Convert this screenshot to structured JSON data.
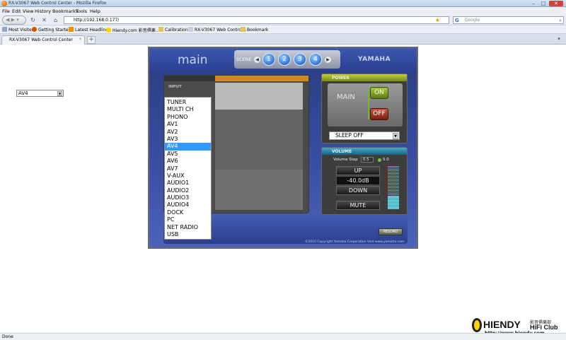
{
  "window": {
    "title": "RX-V3067 Web Control Center - Mozilla Firefox",
    "min": "–",
    "max": "□",
    "close": "✕"
  },
  "menu": [
    "File",
    "Edit",
    "View",
    "History",
    "Bookmarks",
    "Tools",
    "Help"
  ],
  "nav": {
    "url": "http://192.168.0.177/",
    "search_placeholder": "Google"
  },
  "bookmarks": [
    "Most Visited",
    "Getting Started",
    "Latest Headlines",
    "Hiendy.com 影音俱樂...",
    "Calibration",
    "RX-V3067 Web Control...",
    "Bookmark"
  ],
  "tabs": [
    {
      "label": "RX-V3067 Web Control Center"
    }
  ],
  "status": "Done",
  "app": {
    "title": "main",
    "scene_label": "SCENE",
    "scenes": [
      "1",
      "2",
      "3",
      "4"
    ],
    "brand": "YAMAHA",
    "input_label": "INPUT",
    "input_selected": "AV4",
    "input_options": [
      "TUNER",
      "MULTI CH",
      "PHONO",
      "AV1",
      "AV2",
      "AV3",
      "AV4",
      "AV5",
      "AV6",
      "AV7",
      "V-AUX",
      "AUDIO1",
      "AUDIO2",
      "AUDIO3",
      "AUDIO4",
      "DOCK",
      "PC",
      "NET RADIO",
      "USB"
    ],
    "power": {
      "header": "POWER",
      "zone": "MAIN",
      "on": "ON",
      "off": "OFF",
      "sleep": "SLEEP OFF"
    },
    "volume": {
      "header": "VOLUME",
      "step_label": "Volume Step",
      "step_value": "0.5",
      "step_alt": "5.0",
      "up": "UP",
      "level": "-40.0dB",
      "down": "DOWN",
      "mute": "MUTE",
      "meter_fraction": 0.3
    },
    "reload": "RELOAD",
    "copyright": "©2010 Copyright Yamaha Corporation Visit www.yamaha.com"
  },
  "watermark": {
    "brand": "HIENDY",
    "cn": "影音俱樂部",
    "club": "HiFi Club",
    "url": "http://www.hiendy.com"
  },
  "colors": {
    "accent": "#3399ff",
    "power_on": "#7bb329",
    "power_off": "#b0301c",
    "panel_blue": "#2b3f90"
  }
}
